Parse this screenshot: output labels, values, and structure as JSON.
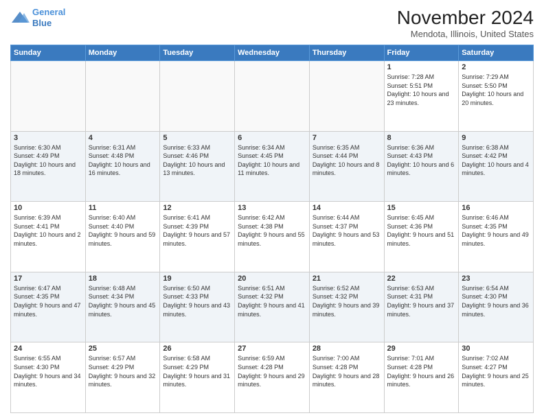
{
  "logo": {
    "line1": "General",
    "line2": "Blue"
  },
  "title": "November 2024",
  "location": "Mendota, Illinois, United States",
  "weekdays": [
    "Sunday",
    "Monday",
    "Tuesday",
    "Wednesday",
    "Thursday",
    "Friday",
    "Saturday"
  ],
  "rows": [
    [
      {
        "day": "",
        "info": ""
      },
      {
        "day": "",
        "info": ""
      },
      {
        "day": "",
        "info": ""
      },
      {
        "day": "",
        "info": ""
      },
      {
        "day": "",
        "info": ""
      },
      {
        "day": "1",
        "info": "Sunrise: 7:28 AM\nSunset: 5:51 PM\nDaylight: 10 hours and 23 minutes."
      },
      {
        "day": "2",
        "info": "Sunrise: 7:29 AM\nSunset: 5:50 PM\nDaylight: 10 hours and 20 minutes."
      }
    ],
    [
      {
        "day": "3",
        "info": "Sunrise: 6:30 AM\nSunset: 4:49 PM\nDaylight: 10 hours and 18 minutes."
      },
      {
        "day": "4",
        "info": "Sunrise: 6:31 AM\nSunset: 4:48 PM\nDaylight: 10 hours and 16 minutes."
      },
      {
        "day": "5",
        "info": "Sunrise: 6:33 AM\nSunset: 4:46 PM\nDaylight: 10 hours and 13 minutes."
      },
      {
        "day": "6",
        "info": "Sunrise: 6:34 AM\nSunset: 4:45 PM\nDaylight: 10 hours and 11 minutes."
      },
      {
        "day": "7",
        "info": "Sunrise: 6:35 AM\nSunset: 4:44 PM\nDaylight: 10 hours and 8 minutes."
      },
      {
        "day": "8",
        "info": "Sunrise: 6:36 AM\nSunset: 4:43 PM\nDaylight: 10 hours and 6 minutes."
      },
      {
        "day": "9",
        "info": "Sunrise: 6:38 AM\nSunset: 4:42 PM\nDaylight: 10 hours and 4 minutes."
      }
    ],
    [
      {
        "day": "10",
        "info": "Sunrise: 6:39 AM\nSunset: 4:41 PM\nDaylight: 10 hours and 2 minutes."
      },
      {
        "day": "11",
        "info": "Sunrise: 6:40 AM\nSunset: 4:40 PM\nDaylight: 9 hours and 59 minutes."
      },
      {
        "day": "12",
        "info": "Sunrise: 6:41 AM\nSunset: 4:39 PM\nDaylight: 9 hours and 57 minutes."
      },
      {
        "day": "13",
        "info": "Sunrise: 6:42 AM\nSunset: 4:38 PM\nDaylight: 9 hours and 55 minutes."
      },
      {
        "day": "14",
        "info": "Sunrise: 6:44 AM\nSunset: 4:37 PM\nDaylight: 9 hours and 53 minutes."
      },
      {
        "day": "15",
        "info": "Sunrise: 6:45 AM\nSunset: 4:36 PM\nDaylight: 9 hours and 51 minutes."
      },
      {
        "day": "16",
        "info": "Sunrise: 6:46 AM\nSunset: 4:35 PM\nDaylight: 9 hours and 49 minutes."
      }
    ],
    [
      {
        "day": "17",
        "info": "Sunrise: 6:47 AM\nSunset: 4:35 PM\nDaylight: 9 hours and 47 minutes."
      },
      {
        "day": "18",
        "info": "Sunrise: 6:48 AM\nSunset: 4:34 PM\nDaylight: 9 hours and 45 minutes."
      },
      {
        "day": "19",
        "info": "Sunrise: 6:50 AM\nSunset: 4:33 PM\nDaylight: 9 hours and 43 minutes."
      },
      {
        "day": "20",
        "info": "Sunrise: 6:51 AM\nSunset: 4:32 PM\nDaylight: 9 hours and 41 minutes."
      },
      {
        "day": "21",
        "info": "Sunrise: 6:52 AM\nSunset: 4:32 PM\nDaylight: 9 hours and 39 minutes."
      },
      {
        "day": "22",
        "info": "Sunrise: 6:53 AM\nSunset: 4:31 PM\nDaylight: 9 hours and 37 minutes."
      },
      {
        "day": "23",
        "info": "Sunrise: 6:54 AM\nSunset: 4:30 PM\nDaylight: 9 hours and 36 minutes."
      }
    ],
    [
      {
        "day": "24",
        "info": "Sunrise: 6:55 AM\nSunset: 4:30 PM\nDaylight: 9 hours and 34 minutes."
      },
      {
        "day": "25",
        "info": "Sunrise: 6:57 AM\nSunset: 4:29 PM\nDaylight: 9 hours and 32 minutes."
      },
      {
        "day": "26",
        "info": "Sunrise: 6:58 AM\nSunset: 4:29 PM\nDaylight: 9 hours and 31 minutes."
      },
      {
        "day": "27",
        "info": "Sunrise: 6:59 AM\nSunset: 4:28 PM\nDaylight: 9 hours and 29 minutes."
      },
      {
        "day": "28",
        "info": "Sunrise: 7:00 AM\nSunset: 4:28 PM\nDaylight: 9 hours and 28 minutes."
      },
      {
        "day": "29",
        "info": "Sunrise: 7:01 AM\nSunset: 4:28 PM\nDaylight: 9 hours and 26 minutes."
      },
      {
        "day": "30",
        "info": "Sunrise: 7:02 AM\nSunset: 4:27 PM\nDaylight: 9 hours and 25 minutes."
      }
    ]
  ]
}
